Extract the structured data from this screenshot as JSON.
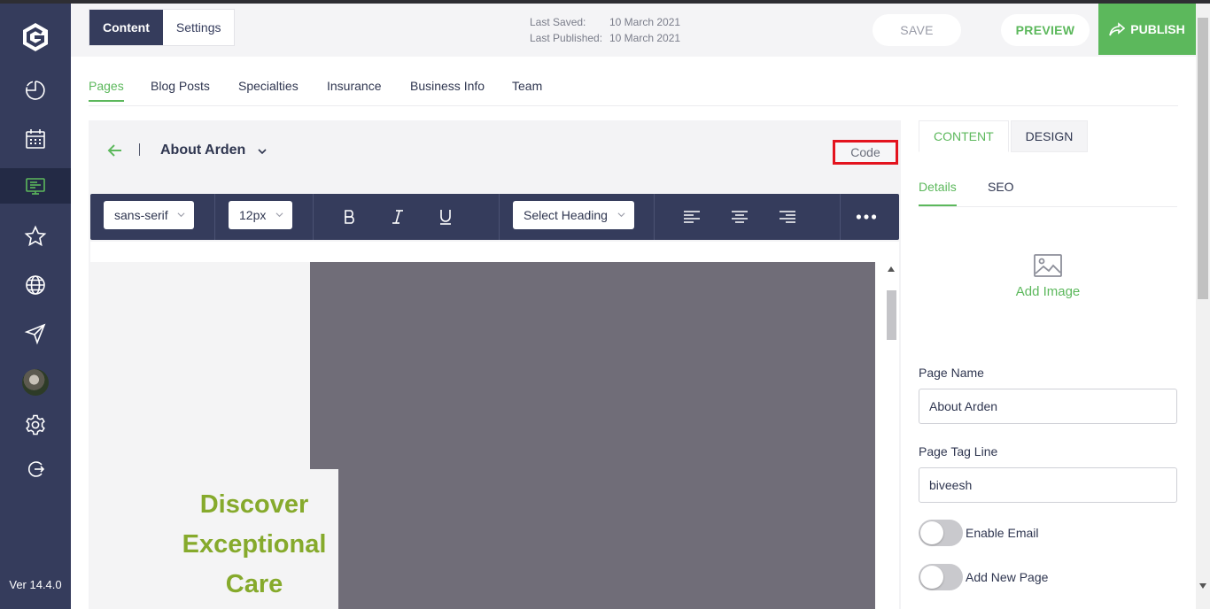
{
  "app": {
    "version": "Ver 14.4.0"
  },
  "sidebar": {
    "items": [
      {
        "name": "dashboard",
        "icon": "pie-chart-icon"
      },
      {
        "name": "calendar",
        "icon": "calendar-icon"
      },
      {
        "name": "website",
        "icon": "monitor-icon",
        "active": true
      },
      {
        "name": "reviews",
        "icon": "star-icon"
      },
      {
        "name": "web",
        "icon": "globe-icon"
      },
      {
        "name": "campaigns",
        "icon": "send-icon"
      },
      {
        "name": "profile",
        "icon": "avatar"
      },
      {
        "name": "settings",
        "icon": "gear-icon"
      },
      {
        "name": "logout",
        "icon": "logout-icon"
      }
    ]
  },
  "topbar": {
    "mode_tabs": [
      "Content",
      "Settings"
    ],
    "last_saved_label": "Last Saved:",
    "last_saved_value": "10 March 2021",
    "last_published_label": "Last Published:",
    "last_published_value": "10 March 2021",
    "save_label": "SAVE",
    "preview_label": "PREVIEW",
    "publish_label": "PUBLISH"
  },
  "nav_tabs": [
    "Pages",
    "Blog Posts",
    "Specialties",
    "Insurance",
    "Business Info",
    "Team"
  ],
  "editor": {
    "page_name": "About Arden",
    "code_label": "Code",
    "toolbar": {
      "font_family": "sans-serif",
      "font_size": "12px",
      "heading": "Select Heading"
    },
    "hero_lines": [
      "Discover",
      "Exceptional",
      "Care"
    ]
  },
  "right_panel": {
    "tabs": [
      "CONTENT",
      "DESIGN"
    ],
    "subtabs": [
      "Details",
      "SEO"
    ],
    "add_image_label": "Add Image",
    "page_name_label": "Page Name",
    "page_name_value": "About Arden",
    "tag_line_label": "Page Tag Line",
    "tag_line_value": "biveesh",
    "enable_email_label": "Enable Email",
    "add_new_page_label": "Add New Page"
  },
  "colors": {
    "sidebar": "#353c5c",
    "accent": "#5cb85c",
    "highlight": "#e3131e",
    "hero_text": "#86aa2c"
  }
}
